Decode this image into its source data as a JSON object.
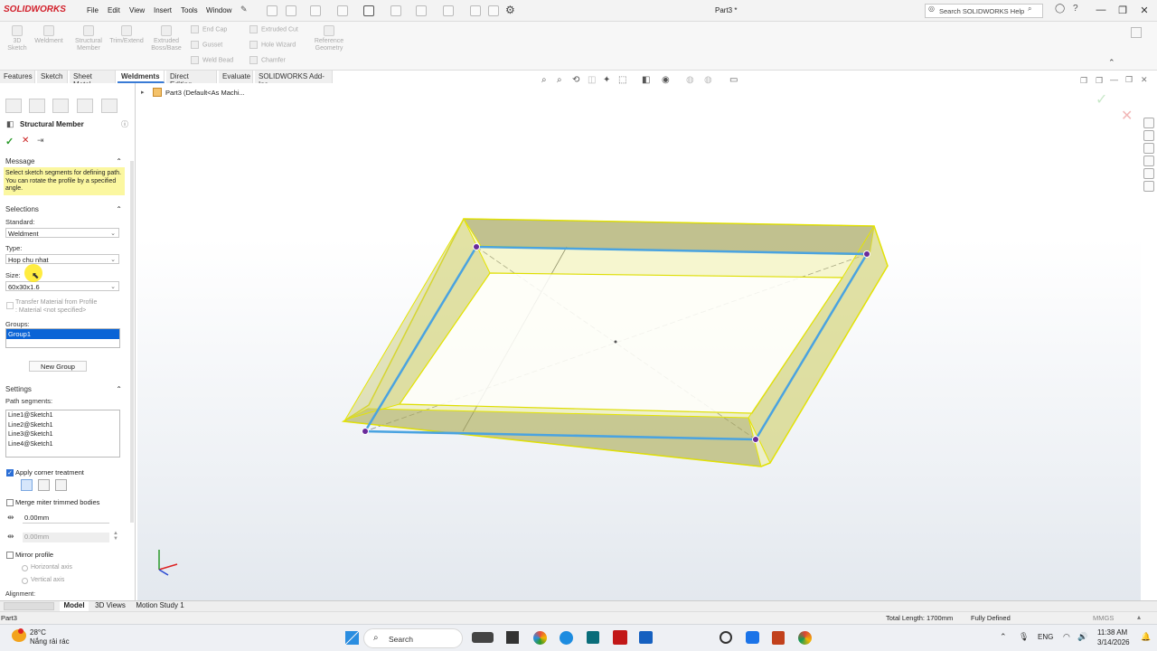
{
  "app": {
    "logo": "SOLIDWORKS",
    "doc_title": "Part3 *"
  },
  "menu": [
    "File",
    "Edit",
    "View",
    "Insert",
    "Tools",
    "Window"
  ],
  "search": {
    "placeholder": "Search SOLIDWORKS Help"
  },
  "command_manager": {
    "large": [
      {
        "label": "3D\nSketch"
      },
      {
        "label": "Weldment"
      },
      {
        "label": "Structural\nMember"
      },
      {
        "label": "Trim/Extend"
      },
      {
        "label": "Extruded\nBoss/Base"
      }
    ],
    "small_col1": [
      "End Cap",
      "Gusset",
      "Weld Bead"
    ],
    "small_col2": [
      "Extruded Cut",
      "Hole Wizard",
      "Chamfer"
    ],
    "reference": "Reference\nGeometry"
  },
  "tabs": [
    "Features",
    "Sketch",
    "Sheet Metal",
    "Weldments",
    "Direct Editing",
    "Evaluate",
    "SOLIDWORKS Add-Ins"
  ],
  "active_tab": "Weldments",
  "tree": {
    "item": "Part3  (Default<As Machi..."
  },
  "panel": {
    "title": "Structural Member",
    "message": {
      "header": "Message",
      "text": "Select sketch segments for defining path. You can rotate the profile by a specified angle."
    },
    "selections": {
      "header": "Selections",
      "standard_label": "Standard:",
      "standard_value": "Weldment",
      "type_label": "Type:",
      "type_value": "Hop chu nhat",
      "size_label": "Size:",
      "size_value": "60x30x1.6",
      "transfer_label": "Transfer Material from Profile",
      "material_label": ": Material <not specified>",
      "groups_label": "Groups:",
      "group_item": "Group1",
      "new_group_button": "New Group"
    },
    "settings": {
      "header": "Settings",
      "path_label": "Path segments:",
      "path_segments": [
        "Line1@Sketch1",
        "Line2@Sketch1",
        "Line3@Sketch1",
        "Line4@Sketch1"
      ],
      "apply_corner": "Apply corner treatment",
      "apply_corner_checked": true,
      "merge_miter": "Merge miter trimmed bodies",
      "gap1": "0.00mm",
      "gap2": "0.00mm",
      "mirror_profile": "Mirror profile",
      "horizontal_axis": "Horizontal axis",
      "vertical_axis": "Vertical axis",
      "alignment": "Alignment:"
    }
  },
  "bottom_tabs": [
    "Model",
    "3D Views",
    "Motion Study 1"
  ],
  "active_bottom_tab": "Model",
  "status": {
    "left": "Part3",
    "total_length": "Total Length: 1700mm",
    "state": "Fully Defined",
    "units": "MMGS"
  },
  "taskbar": {
    "weather_temp": "28°C",
    "weather_desc": "Nắng rải rác",
    "search_label": "Search",
    "lang": "ENG",
    "time": "11:38 AM",
    "date": "3/14/2026"
  },
  "colors": {
    "accent": "#2b6fd6",
    "frame_yellow": "#e8e84a",
    "path_blue": "#4aa3e0",
    "message_bg": "#fbf7a0"
  }
}
